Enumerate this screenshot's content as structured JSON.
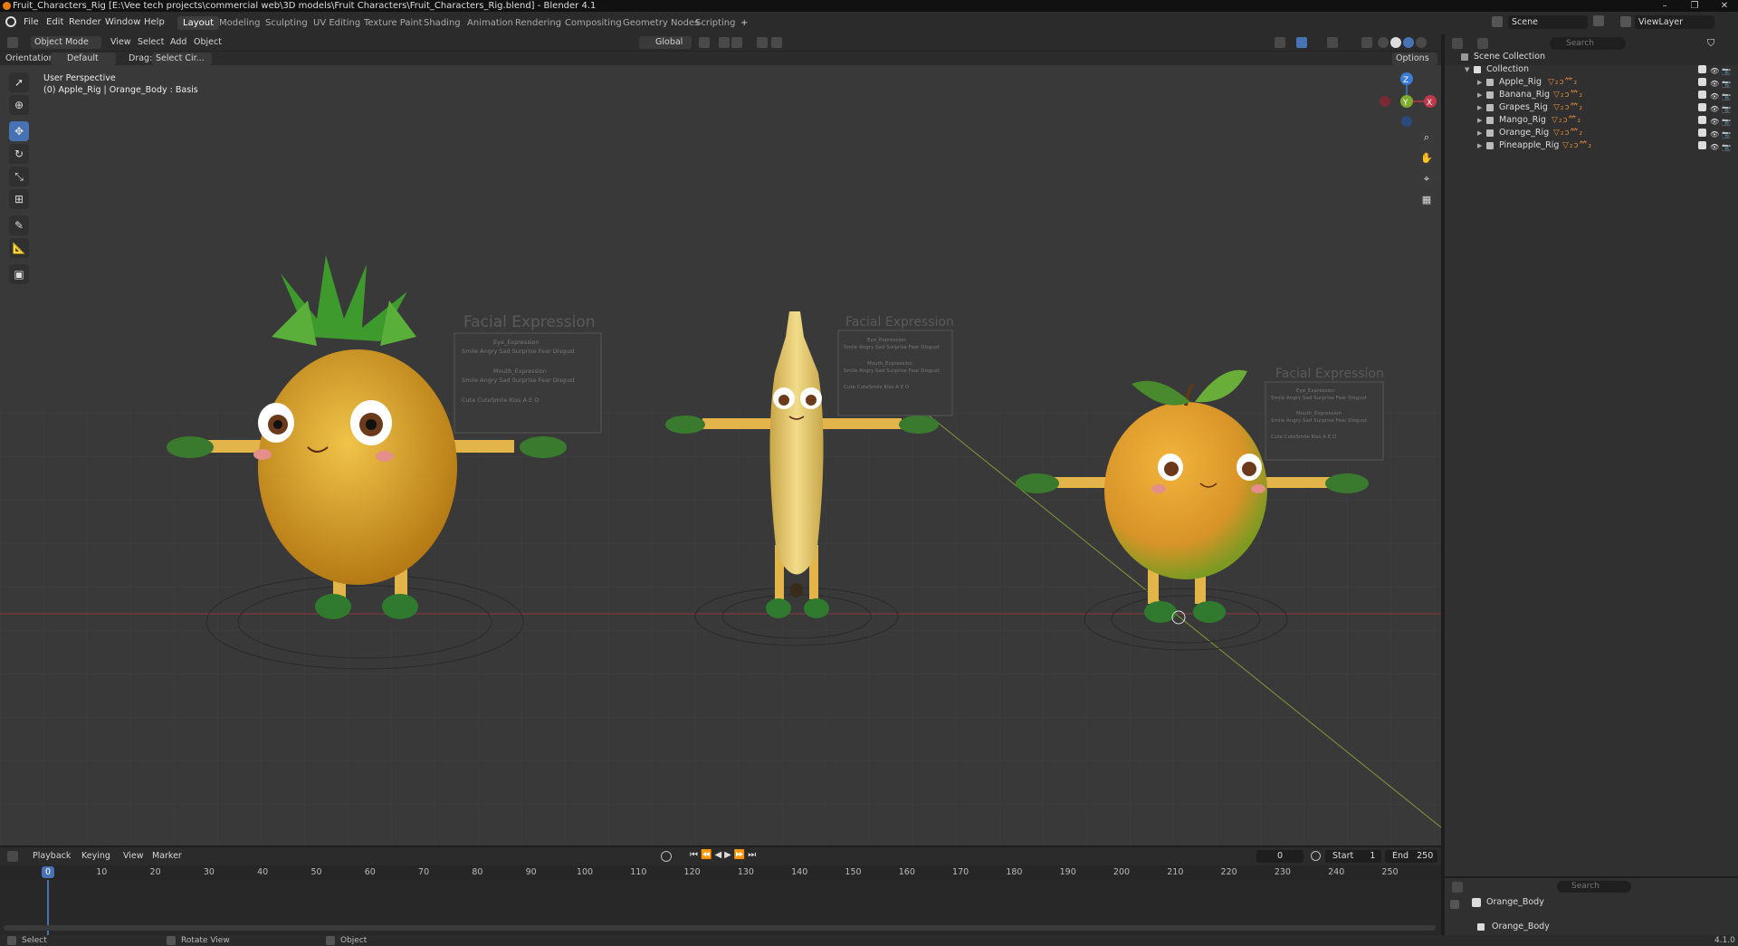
{
  "window": {
    "title": "Fruit_Characters_Rig [E:\\Vee tech projects\\commercial web\\3D models\\Fruit Characters\\Fruit_Characters_Rig.blend] - Blender 4.1"
  },
  "menus": [
    "File",
    "Edit",
    "Render",
    "Window",
    "Help"
  ],
  "workspaces": [
    "Layout",
    "Modeling",
    "Sculpting",
    "UV Editing",
    "Texture Paint",
    "Shading",
    "Animation",
    "Rendering",
    "Compositing",
    "Geometry Nodes",
    "Scripting"
  ],
  "active_workspace": "Layout",
  "top_right": {
    "scene_label": "Scene",
    "viewlayer_label": "ViewLayer"
  },
  "viewport_header": {
    "mode": "Object Mode",
    "menus": [
      "View",
      "Select",
      "Add",
      "Object"
    ],
    "transform_orientation": "Global"
  },
  "tool_options": {
    "orientation_label": "Orientation:",
    "orientation_value": "Default",
    "drag_label": "Drag:",
    "drag_value": "Select Cir...",
    "options_label": "Options"
  },
  "viewport": {
    "perspective_label": "User Perspective",
    "object_info": "(0) Apple_Rig | Orange_Body : Basis",
    "board_title": "Facial Expression",
    "board_eye_label": "Eye_Expression",
    "board_mouth_label": "Mouth_Expression",
    "board_eye_row": "Smile  Angry  Sad  Surprise  Fear  Disgust",
    "board_mouth_row": "Smile  Angry  Sad  Surprise  Fear  Disgust",
    "board_bottom_row": "Cute  CuteSmile  Kiss  A  E  O",
    "gizmo_labels": [
      "Z",
      "Y",
      "X"
    ]
  },
  "outliner": {
    "search_placeholder": "Search",
    "scene_collection": "Scene Collection",
    "collection": "Collection",
    "items": [
      {
        "label": "Apple_Rig",
        "mods": "▽₂ↄ⺮₂"
      },
      {
        "label": "Banana_Rig",
        "mods": "▽₂ↄ⺮₂"
      },
      {
        "label": "Grapes_Rig",
        "mods": "▽₂ↄ⺮₂"
      },
      {
        "label": "Mango_Rig",
        "mods": "▽₂ↄ⺮₂"
      },
      {
        "label": "Orange_Rig",
        "mods": "▽₂ↄ⺮₂"
      },
      {
        "label": "Pineapple_Rig",
        "mods": "▽₂ↄ⺮₂"
      }
    ]
  },
  "properties": {
    "search_placeholder": "Search",
    "object_name": "Orange_Body",
    "data_name": "Orange_Body"
  },
  "timeline": {
    "menus": [
      "Playback",
      "Keying",
      "View",
      "Marker"
    ],
    "current_frame": "0",
    "start_label": "Start",
    "start_value": "1",
    "end_label": "End",
    "end_value": "250",
    "ruler": [
      "0",
      "10",
      "20",
      "30",
      "40",
      "50",
      "60",
      "70",
      "80",
      "90",
      "100",
      "110",
      "120",
      "130",
      "140",
      "150",
      "160",
      "170",
      "180",
      "190",
      "200",
      "210",
      "220",
      "230",
      "240",
      "250"
    ]
  },
  "statusbar": {
    "select": "Select",
    "rotate": "Rotate View",
    "object": "Object",
    "version": "4.1.0"
  },
  "colors": {
    "accent": "#4772b3",
    "orange": "#e87d0d",
    "axis_x": "#c0374a",
    "axis_y": "#7fab2e",
    "axis_z": "#3a7bd5"
  }
}
